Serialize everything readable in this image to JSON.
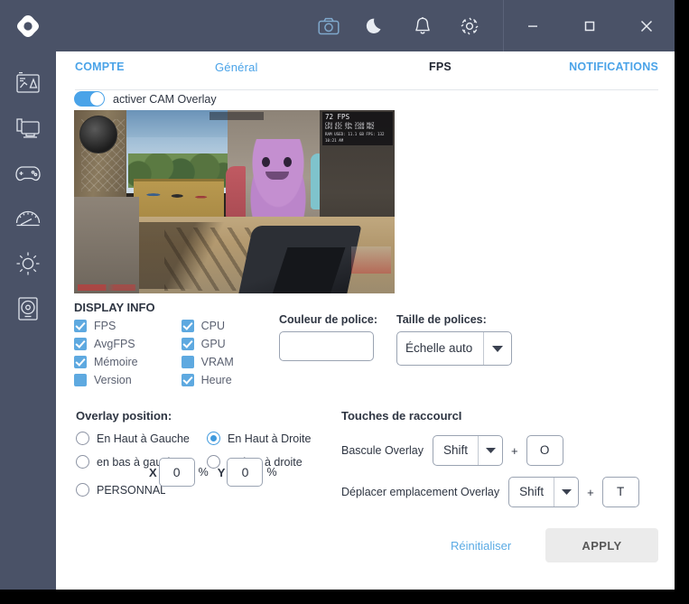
{
  "window": {
    "logo": "nzxt-cam-logo",
    "titlebar_icons": [
      {
        "name": "camera-icon",
        "label": "Capture d'écran"
      },
      {
        "name": "moon-icon",
        "label": "Mode nuit"
      },
      {
        "name": "bell-icon",
        "label": "Notifications"
      },
      {
        "name": "gear-icon",
        "label": "Paramètres"
      }
    ],
    "controls": [
      {
        "name": "minimize-button",
        "glyph": "—"
      },
      {
        "name": "maximize-button",
        "glyph": "□"
      },
      {
        "name": "close-button",
        "glyph": "✕"
      }
    ]
  },
  "sidebar": {
    "items": [
      {
        "name": "sidebar-item-dashboard",
        "icon": "chart-monitor-icon"
      },
      {
        "name": "sidebar-item-pc-monitoring",
        "icon": "desktop-icon"
      },
      {
        "name": "sidebar-item-games",
        "icon": "gamepad-icon"
      },
      {
        "name": "sidebar-item-overclocking",
        "icon": "gauge-icon"
      },
      {
        "name": "sidebar-item-lighting",
        "icon": "sun-icon"
      },
      {
        "name": "sidebar-item-storage",
        "icon": "disk-drive-icon"
      }
    ]
  },
  "tabs": [
    {
      "label": "COMPTE",
      "active": false
    },
    {
      "label": "Général",
      "active": false
    },
    {
      "label": "FPS",
      "active": true
    },
    {
      "label": "NOTIFICATIONS",
      "active": false
    }
  ],
  "overlay_toggle": {
    "label": "activer CAM Overlay",
    "enabled": true
  },
  "preview": {
    "alt": "aperçu du jeu avec overlay FPS",
    "overlay": {
      "fps": "72 FPS",
      "cpu_row": "CPU  45C  40%  3500 MHZ",
      "gpu_row": "GPU  65C  70%  1380 MHZ",
      "ram_row": "RAM USED: 11.1 GB   FPS: 132",
      "time": "10:21 AM"
    }
  },
  "display_info": {
    "title": "DISPLAY INFO",
    "column_left": [
      {
        "label": "FPS",
        "checked": true
      },
      {
        "label": "AvgFPS",
        "checked": true
      },
      {
        "label": "Mémoire",
        "checked": true
      },
      {
        "label": "Version",
        "checked": false
      }
    ],
    "column_right": [
      {
        "label": "CPU",
        "checked": true
      },
      {
        "label": "GPU",
        "checked": true
      },
      {
        "label": "VRAM",
        "checked": false
      },
      {
        "label": "Heure",
        "checked": true
      }
    ]
  },
  "font_color": {
    "label": "Couleur de police:",
    "value": ""
  },
  "font_size": {
    "label": "Taille de polices:",
    "value": "Échelle auto"
  },
  "overlay_position": {
    "title": "Overlay position:",
    "options": [
      {
        "label": "En Haut à Gauche",
        "selected": false
      },
      {
        "label": "en bas à gauche",
        "selected": false
      },
      {
        "label": "En Haut à Droite",
        "selected": true
      },
      {
        "label": "en bas à droite",
        "selected": false
      },
      {
        "label": "PERSONNALISÉ",
        "selected": false
      }
    ],
    "x_label": "X",
    "x_value": "0",
    "y_label": "Y",
    "y_value": "0",
    "percent": "%"
  },
  "shortcuts": {
    "title": "Touches de raccourcI",
    "rows": [
      {
        "label": "Bascule Overlay",
        "modifier": "Shift",
        "plus": "+",
        "key": "O"
      },
      {
        "label": "Déplacer emplacement Overlay",
        "modifier": "Shift",
        "plus": "+",
        "key": "T"
      }
    ]
  },
  "footer": {
    "reset_label": "Réinitialiser",
    "apply_label": "APPLY"
  },
  "colors": {
    "chrome": "#4a5267",
    "accent": "#4aa3e8",
    "checkbox": "#5ea9e0",
    "apply_bg": "#ebebeb"
  }
}
